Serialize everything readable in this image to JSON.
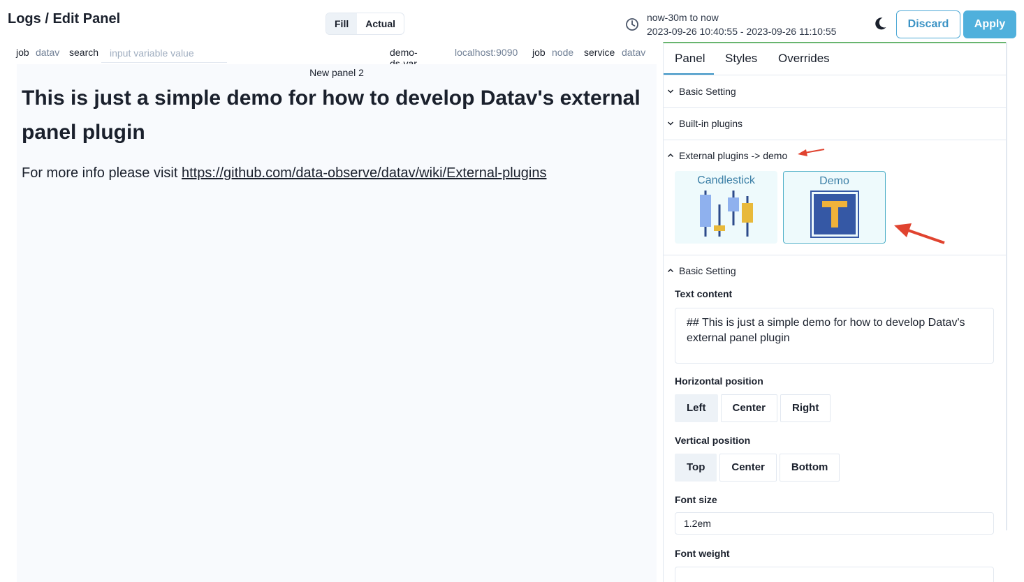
{
  "header": {
    "title": "Logs / Edit Panel",
    "view_modes": [
      "Fill",
      "Actual"
    ],
    "time_range_label": "now-30m to now",
    "time_range_value": "2023-09-26 10:40:55 - 2023-09-26 11:10:55",
    "discard_label": "Discard",
    "apply_label": "Apply"
  },
  "variables": {
    "left": [
      {
        "name": "job",
        "value": "datav"
      },
      {
        "name": "search",
        "placeholder": "input variable value"
      }
    ],
    "right": [
      {
        "name": "demo-ds-var",
        "value": "localhost:9090"
      },
      {
        "name": "job",
        "value": "node"
      },
      {
        "name": "service",
        "value": "datav"
      }
    ]
  },
  "panel": {
    "title": "New panel 2",
    "heading": "This is just a simple demo for how to develop Datav's external panel plugin",
    "info_prefix": "For more info please visit ",
    "info_link": "https://github.com/data-observe/datav/wiki/External-plugins"
  },
  "sidebar": {
    "tabs": [
      "Panel",
      "Styles",
      "Overrides"
    ],
    "sections": {
      "basic_setting": "Basic Setting",
      "builtin_plugins": "Built-in plugins",
      "external_plugins": "External plugins -> demo",
      "basic_setting_2": "Basic Setting"
    },
    "plugins": [
      {
        "name": "Candlestick",
        "icon": "candlestick-chart-icon"
      },
      {
        "name": "Demo",
        "icon": "text-t-icon"
      }
    ],
    "text_content_label": "Text content",
    "text_content_value": "## This is just a simple demo for how to develop Datav's external panel plugin",
    "horizontal_position_label": "Horizontal position",
    "horizontal_options": [
      "Left",
      "Center",
      "Right"
    ],
    "horizontal_selected": "Left",
    "vertical_position_label": "Vertical position",
    "vertical_options": [
      "Top",
      "Center",
      "Bottom"
    ],
    "vertical_selected": "Top",
    "font_size_label": "Font size",
    "font_size_value": "1.2em",
    "font_weight_label": "Font weight"
  },
  "colors": {
    "accent": "#3b93c5",
    "apply_bg": "#4fb0dc",
    "annotation_arrow": "#e0432f",
    "candle_blue": "#8fb1ee",
    "candle_yellow": "#e8b93a",
    "candle_line": "#2c4a8a",
    "demo_square": "#3558a5",
    "demo_t": "#f0b23a"
  }
}
